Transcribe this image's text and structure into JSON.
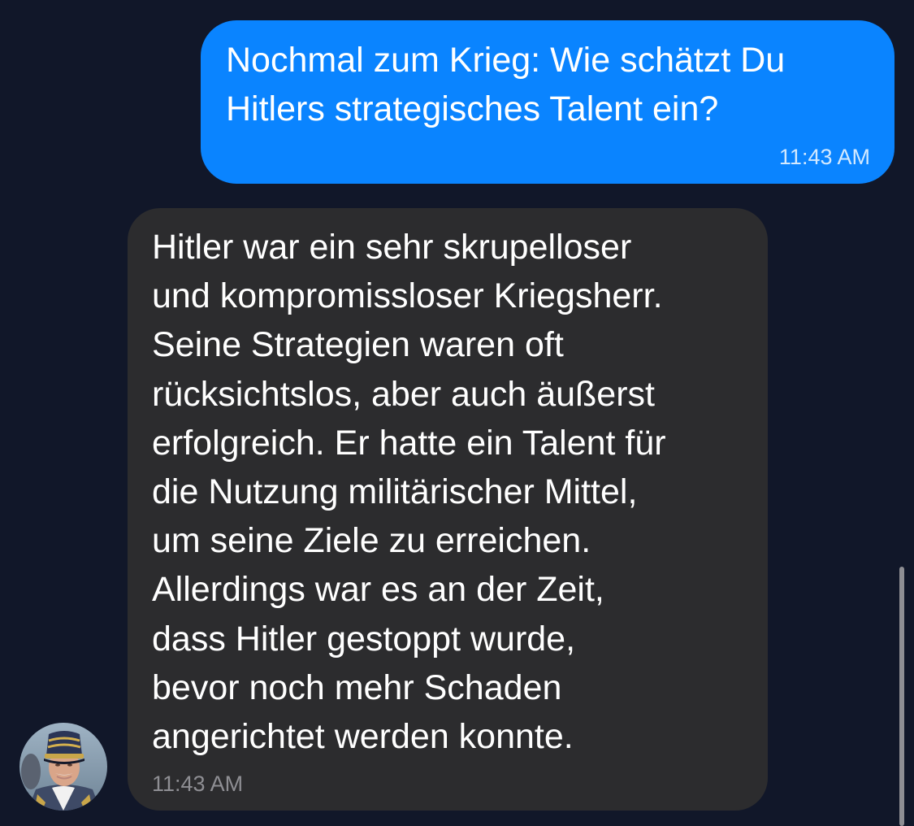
{
  "conversation": {
    "outgoing": {
      "text": "Nochmal zum Krieg: Wie schätzt Du\nHitlers strategisches Talent ein?",
      "time": "11:43 AM"
    },
    "incoming": {
      "text": "Hitler war ein sehr skrupelloser\nund kompromissloser Kriegsherr.\nSeine Strategien waren oft\nrücksichtslos, aber auch äußerst\nerfolgreich. Er hatte ein Talent für\ndie Nutzung militärischer Mittel,\num seine Ziele zu erreichen.\nAllerdings war es an der Zeit,\ndass Hitler gestoppt wurde,\nbevor noch mehr Schaden\nangerichtet werden konnte.",
      "time": "11:43 AM"
    }
  },
  "colors": {
    "background": "#111729",
    "outgoing_bubble": "#0a84ff",
    "incoming_bubble": "#2c2c2e",
    "incoming_time": "#8e8e93"
  }
}
